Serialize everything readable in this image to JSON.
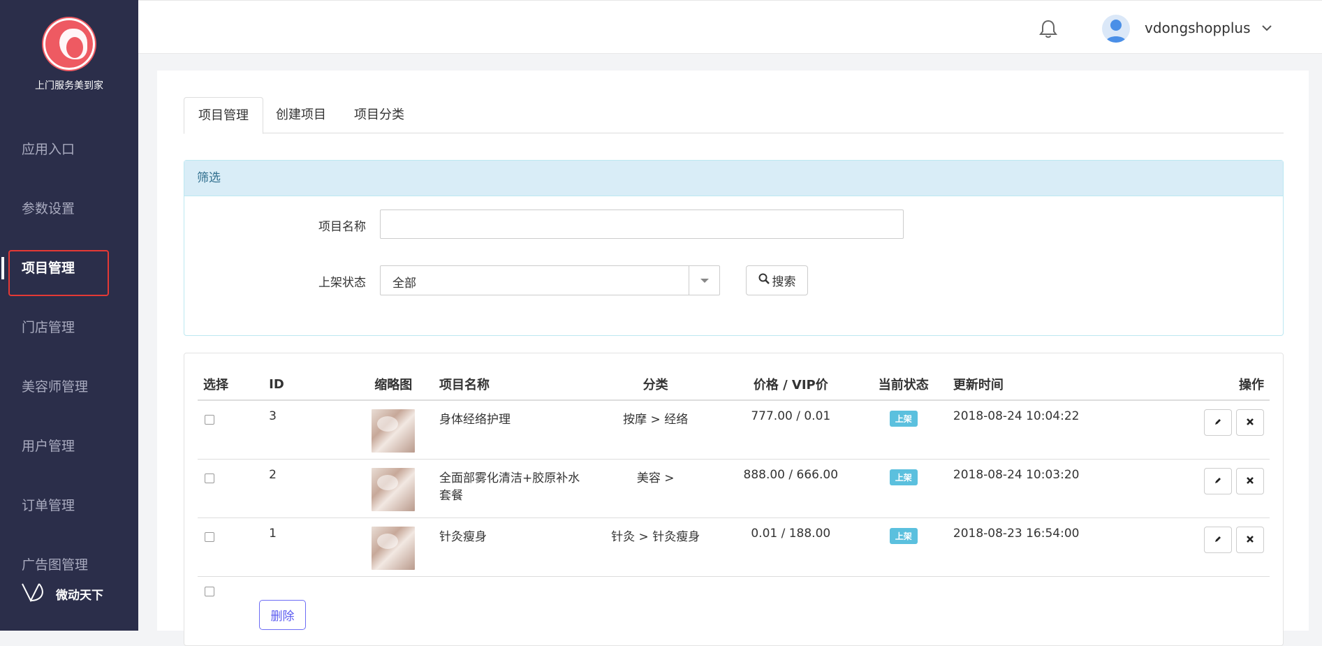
{
  "sidebar": {
    "brand_name": "上门服务美到家",
    "items": [
      {
        "label": "应用入口"
      },
      {
        "label": "参数设置"
      },
      {
        "label": "项目管理"
      },
      {
        "label": "门店管理"
      },
      {
        "label": "美容师管理"
      },
      {
        "label": "用户管理"
      },
      {
        "label": "订单管理"
      },
      {
        "label": "广告图管理"
      }
    ],
    "active_item": "项目管理",
    "footer_brand": "微动天下"
  },
  "header": {
    "username": "vdongshopplus",
    "icons": [
      "bell-icon",
      "user-avatar",
      "chevron-down-icon"
    ]
  },
  "tabs": [
    {
      "label": "项目管理",
      "active": true
    },
    {
      "label": "创建项目",
      "active": false
    },
    {
      "label": "项目分类",
      "active": false
    }
  ],
  "filter": {
    "title": "筛选",
    "name_label": "项目名称",
    "name_value": "",
    "status_label": "上架状态",
    "status_value": "全部",
    "search_label": "搜索"
  },
  "table": {
    "headers": {
      "select": "选择",
      "id": "ID",
      "thumb": "缩略图",
      "name": "项目名称",
      "category": "分类",
      "price": "价格 / VIP价",
      "status": "当前状态",
      "updated": "更新时间",
      "ops": "操作"
    },
    "rows": [
      {
        "id": "3",
        "name": "身体经络护理",
        "category": "按摩 > 经络",
        "price": "777.00 / 0.01",
        "status": "上架",
        "updated": "2018-08-24 10:04:22"
      },
      {
        "id": "2",
        "name": "全面部雾化清洁+胶原补水套餐",
        "category": "美容 >",
        "price": "888.00 / 666.00",
        "status": "上架",
        "updated": "2018-08-24 10:03:20"
      },
      {
        "id": "1",
        "name": "针灸瘦身",
        "category": "针灸 > 针灸瘦身",
        "price": "0.01 / 188.00",
        "status": "上架",
        "updated": "2018-08-23 16:54:00"
      }
    ],
    "delete_label": "删除"
  },
  "colors": {
    "sidebar_bg": "#2b2e4a",
    "brand": "#ee5a62",
    "badge": "#5bc0de",
    "filter_head": "#d9edf7",
    "highlight": "#e53935"
  }
}
